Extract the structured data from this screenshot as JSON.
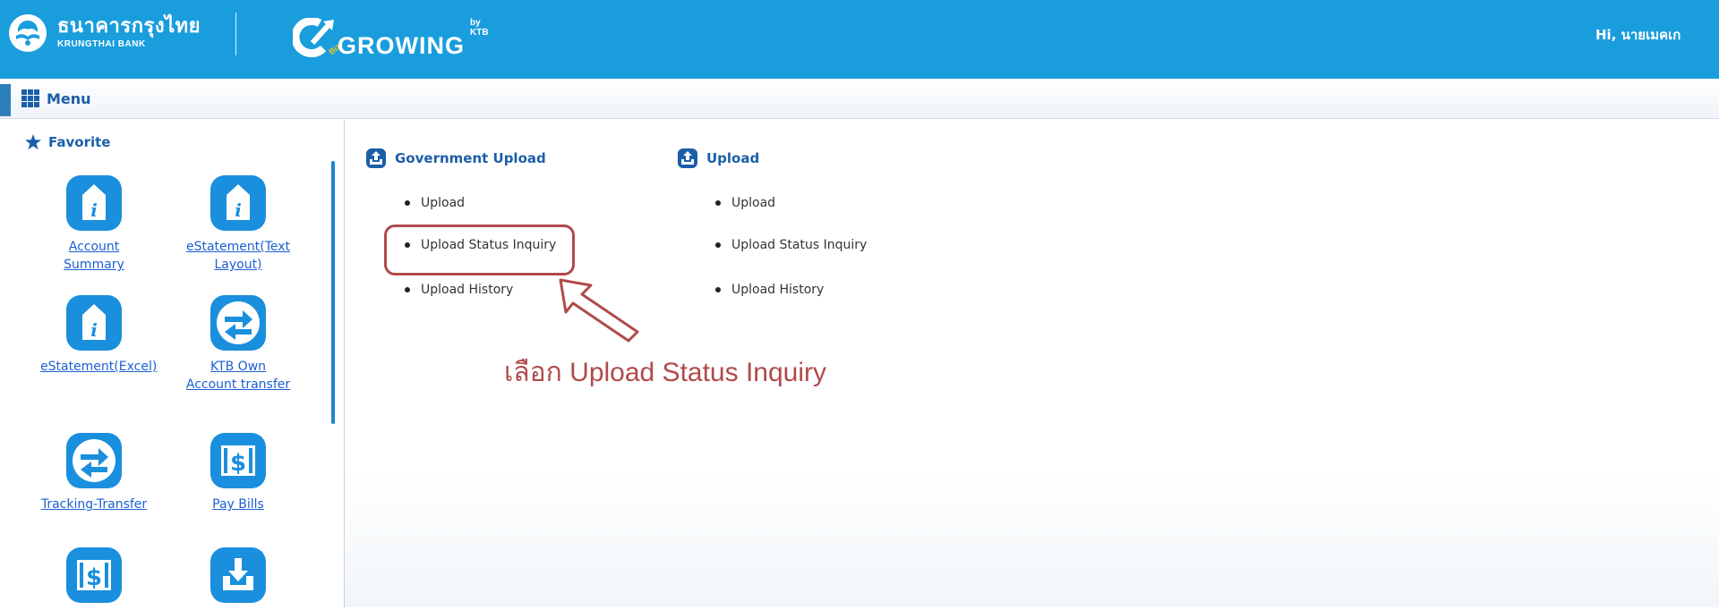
{
  "header": {
    "bank_name_thai": "ธนาคารกรุงไทย",
    "bank_name_eng": "KRUNGTHAI BANK",
    "product_name": "GROWING",
    "product_prefix": "Biz",
    "product_by": "by KTB",
    "greeting": "Hi, นายเมคเก"
  },
  "menu": {
    "title": "Menu"
  },
  "favorite": {
    "title": "Favorite",
    "items": [
      {
        "label": "Account Summary",
        "icon": "info-document-icon"
      },
      {
        "label": "eStatement(Text Layout)",
        "icon": "info-document-icon"
      },
      {
        "label": "eStatement(Excel)",
        "icon": "info-document-icon"
      },
      {
        "label": "KTB Own Account transfer",
        "icon": "transfer-arrows-icon"
      },
      {
        "label": "Tracking-Transfer",
        "icon": "transfer-arrows-icon"
      },
      {
        "label": "Pay Bills",
        "icon": "dollar-bill-icon"
      },
      {
        "label": "",
        "icon": "dollar-bill-icon"
      },
      {
        "label": "",
        "icon": "download-tray-icon"
      }
    ]
  },
  "groups": [
    {
      "title": "Government Upload",
      "links": [
        "Upload",
        "Upload Status Inquiry",
        "Upload History"
      ]
    },
    {
      "title": "Upload",
      "links": [
        "Upload",
        "Upload Status Inquiry",
        "Upload History"
      ]
    }
  ],
  "annotation": {
    "text": "เลือก Upload Status Inquiry"
  },
  "colors": {
    "header_bg": "#1a9ddd",
    "accent_blue": "#1b5fa8",
    "icon_blue": "#1a8fdd",
    "link_blue": "#1b5fd3",
    "annotation_red": "#b04a4a"
  }
}
